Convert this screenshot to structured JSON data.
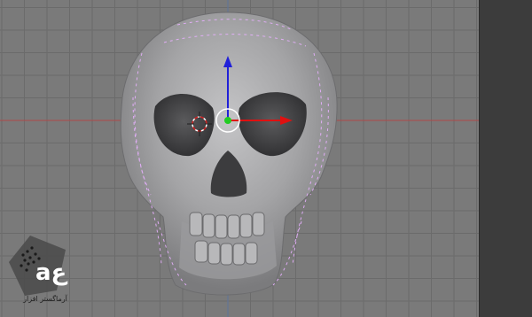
{
  "viewport": {
    "background": "#7a7a7a",
    "grid_color": "#6b6b6b",
    "axis_x_color": "#b04848",
    "axis_y_color": "#5a78b0"
  },
  "gizmo": {
    "x_axis_color": "#e01010",
    "z_axis_color": "#2020d8",
    "center_color": "#22cc22"
  },
  "model": {
    "name": "skull",
    "base_color": "#a9a9ab",
    "wire_color": "#e8b0ff"
  },
  "watermark": {
    "logo_text": "aع",
    "caption": "آرماگستر افزار"
  }
}
